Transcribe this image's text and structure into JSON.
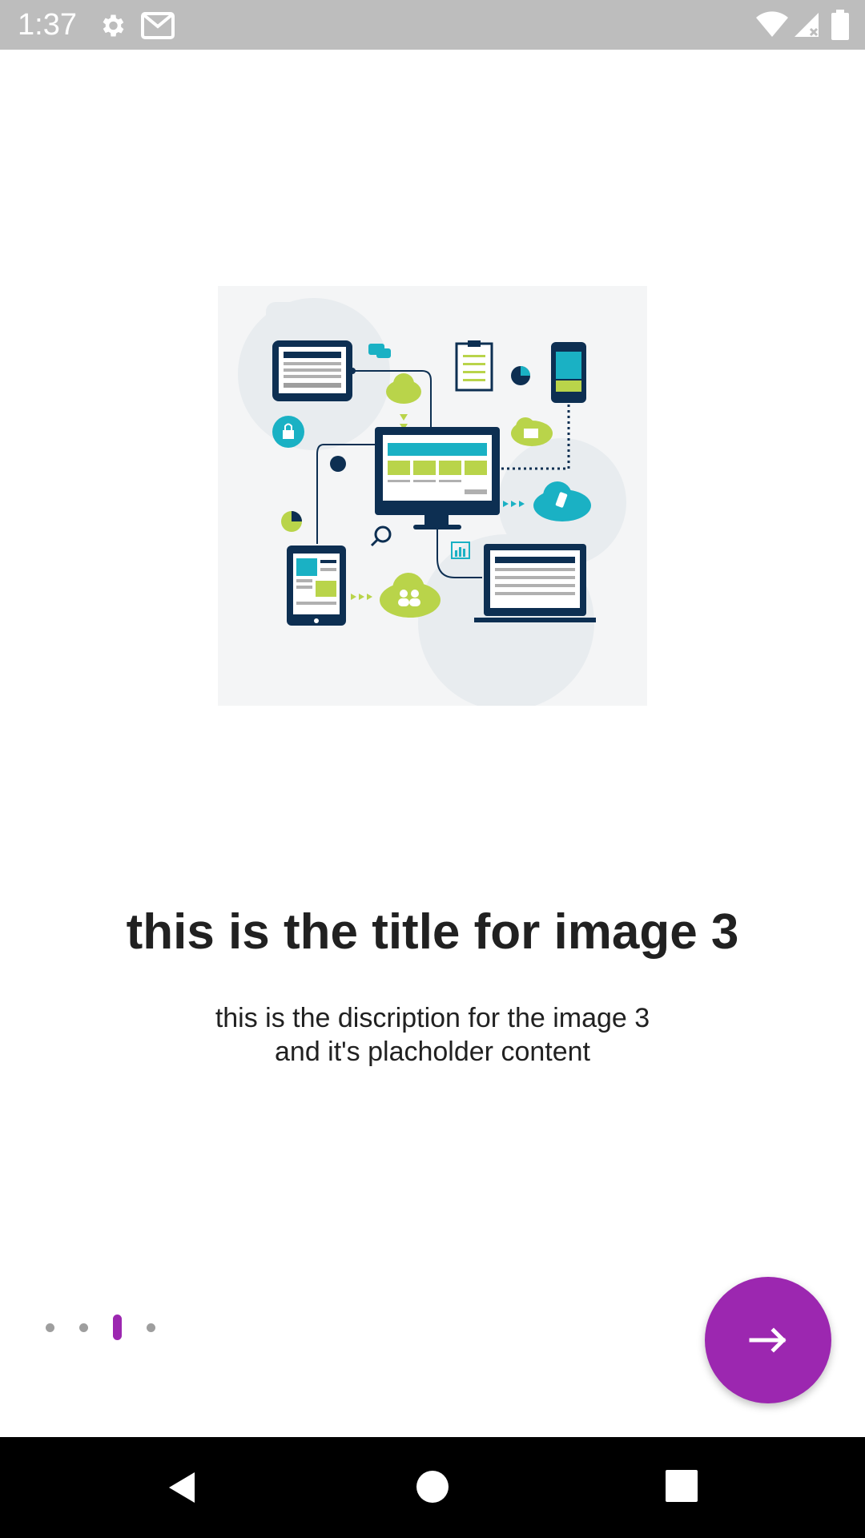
{
  "status_bar": {
    "time": "1:37",
    "icons": [
      "gear-icon",
      "gmail-icon",
      "wifi-icon",
      "signal-icon",
      "battery-icon"
    ]
  },
  "onboarding": {
    "title": "this is the title for image 3",
    "description_lines": [
      "this is the discription for the image 3",
      "and it's placholder content"
    ],
    "page_indicator": {
      "total": 4,
      "current": 3
    },
    "next_button_icon": "arrow-right-icon"
  },
  "colors": {
    "accent": "#9c27b0",
    "status_bar": "#bdbdbd",
    "nav_bar": "#000000",
    "dot_inactive": "#9e9e9e",
    "text": "#212121"
  },
  "nav_bar": {
    "buttons": [
      "back-icon",
      "home-icon",
      "recents-icon"
    ]
  }
}
